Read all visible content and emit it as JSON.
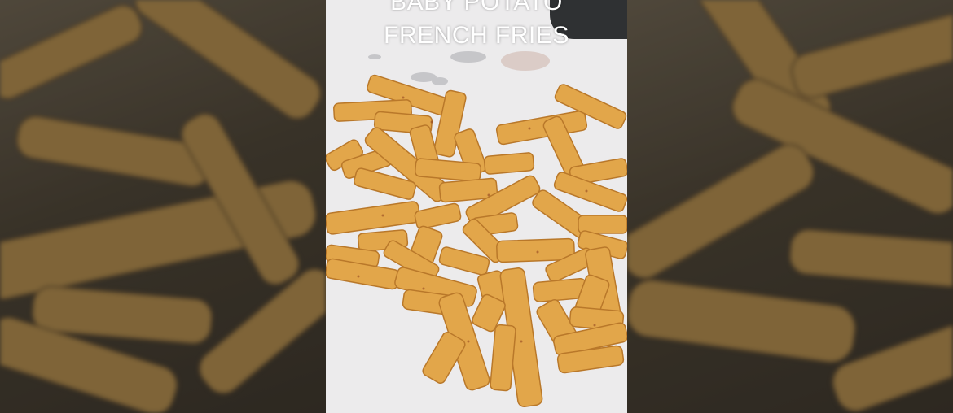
{
  "overlay": {
    "line1": "BABY POTATO",
    "line2": "FRENCH FRIES"
  },
  "image": {
    "subject-icon": "french-fries",
    "colors": {
      "fry": "#e2a64a",
      "fry_dark": "#b9782a",
      "paper": "#ecebec",
      "background": "#3a342a"
    }
  }
}
